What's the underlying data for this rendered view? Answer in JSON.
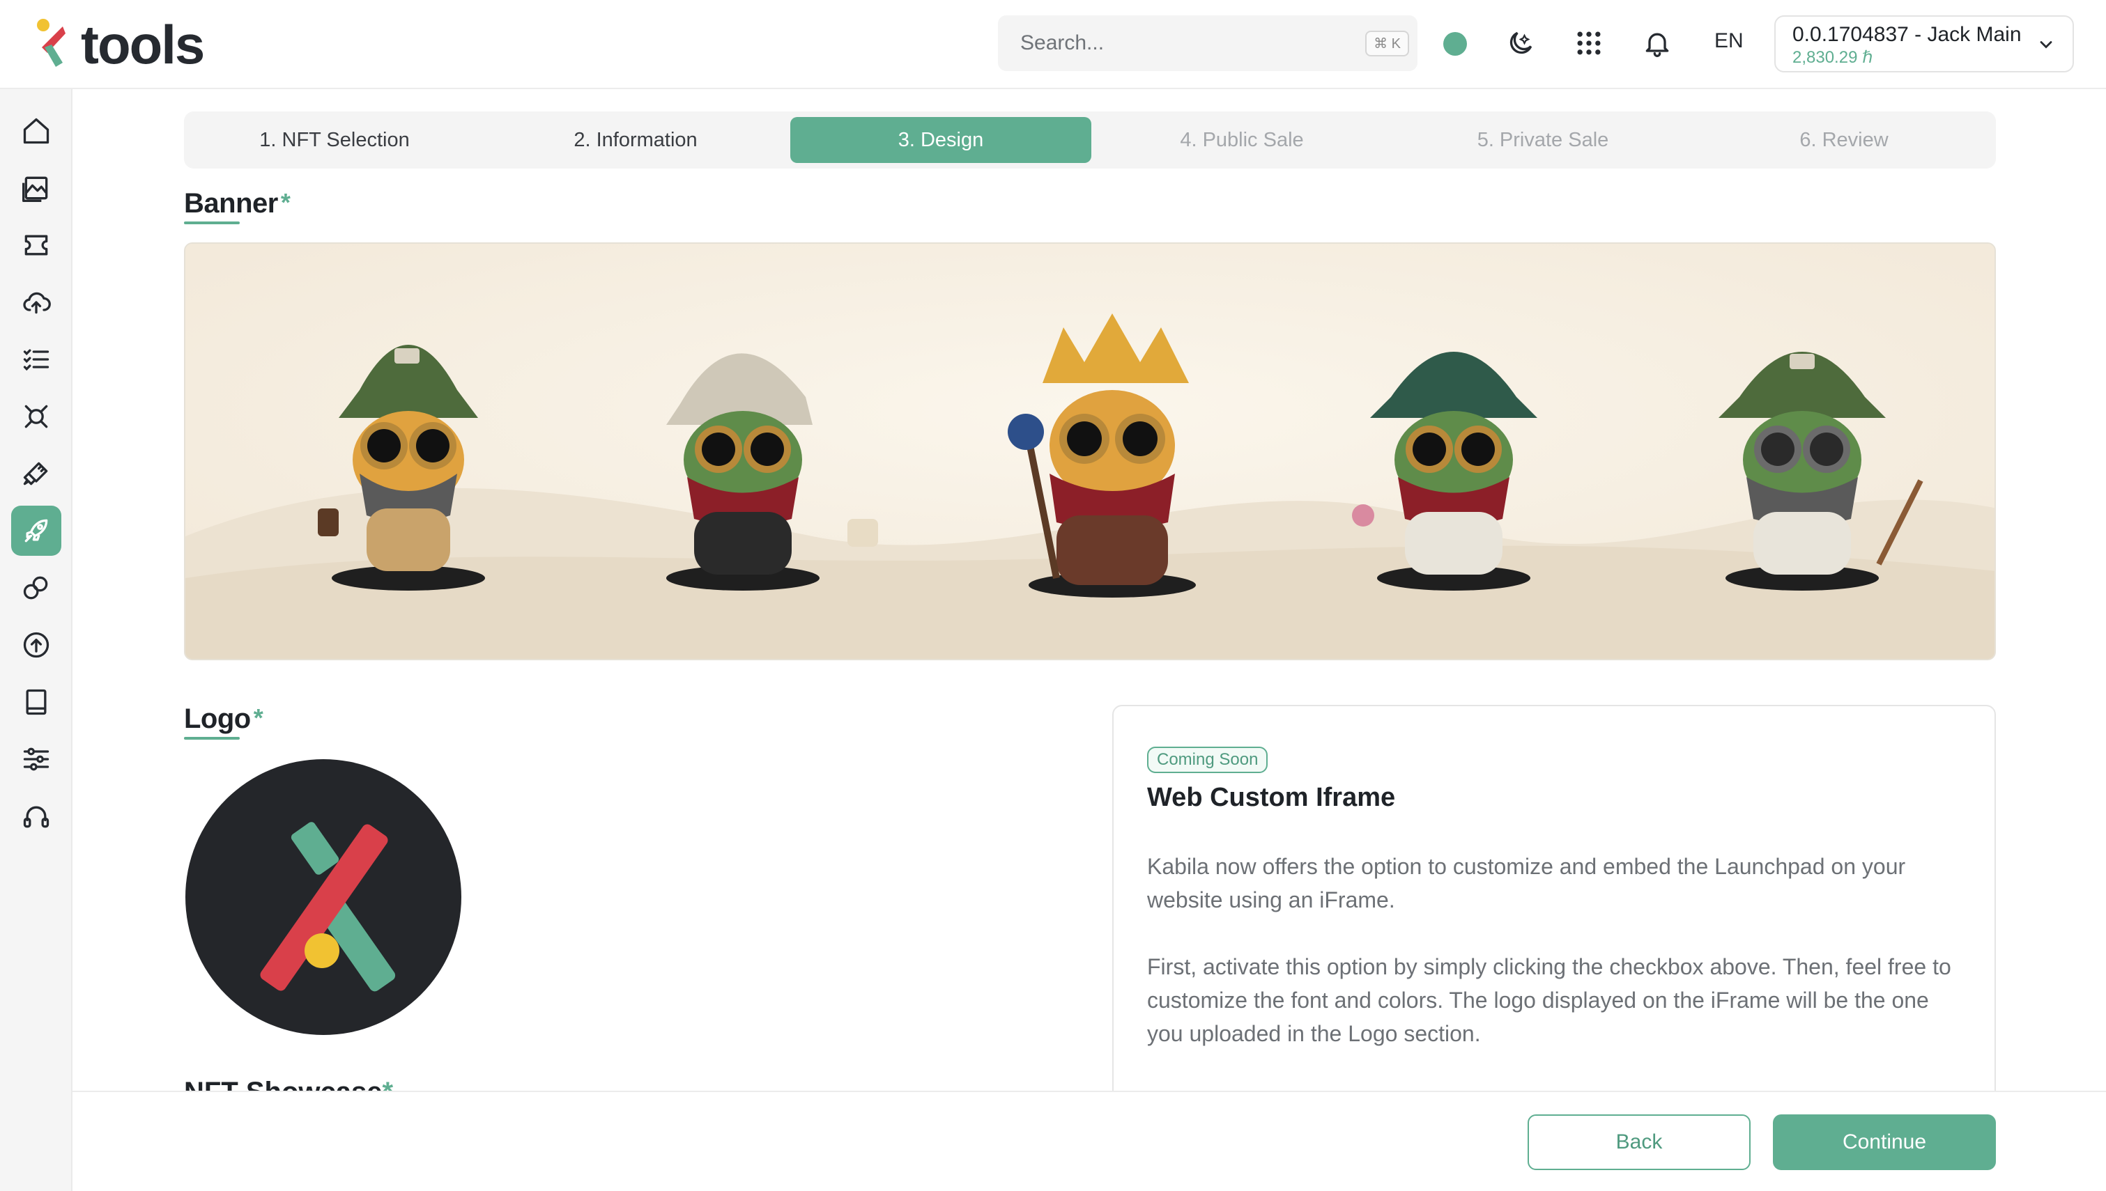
{
  "app": {
    "logo_text": "tools"
  },
  "header": {
    "search_placeholder": "Search...",
    "search_shortcut": "⌘ K",
    "language": "EN",
    "account_name": "0.0.1704837 - Jack Main",
    "account_balance": "2,830.29 ℏ",
    "icons": [
      "status-dot",
      "theme-toggle-icon",
      "apps-grid-icon",
      "bell-icon",
      "chevron-down-icon"
    ]
  },
  "sidebar": {
    "active_index": 7,
    "items": [
      "home-icon",
      "gallery-icon",
      "ticket-icon",
      "cloud-upload-icon",
      "checklist-icon",
      "network-icon",
      "brush-icon",
      "rocket-icon",
      "link-icon",
      "arrow-up-circle-icon",
      "book-icon",
      "sliders-icon",
      "headset-icon"
    ]
  },
  "stepper": {
    "steps": [
      {
        "label": "1. NFT Selection",
        "state": "done"
      },
      {
        "label": "2. Information",
        "state": "done"
      },
      {
        "label": "3. Design",
        "state": "active"
      },
      {
        "label": "4. Public Sale",
        "state": "future"
      },
      {
        "label": "5. Private Sale",
        "state": "future"
      },
      {
        "label": "6. Review",
        "state": "future"
      }
    ]
  },
  "banner": {
    "title": "Banner",
    "required_mark": "*"
  },
  "logo_section": {
    "title": "Logo",
    "required_mark": "*"
  },
  "iframe_card": {
    "badge": "Coming Soon",
    "title": "Web Custom Iframe",
    "paragraph_1": "Kabila now offers the option to customize and embed the Launchpad on your website using an iFrame.",
    "paragraph_2": "First, activate this option by simply clicking the checkbox above. Then, feel free to customize the font and colors. The logo displayed on the iFrame will be the one you uploaded in the Logo section."
  },
  "nft_section": {
    "title_partial": "NFT Showcase",
    "required_mark": "*"
  },
  "footer": {
    "back_label": "Back",
    "continue_label": "Continue"
  },
  "colors": {
    "accent": "#5fae91",
    "text": "#1f2328",
    "muted": "#6c7075",
    "logo_bg": "#24262a",
    "logo_red": "#d9404a",
    "logo_yellow": "#f1c232"
  }
}
